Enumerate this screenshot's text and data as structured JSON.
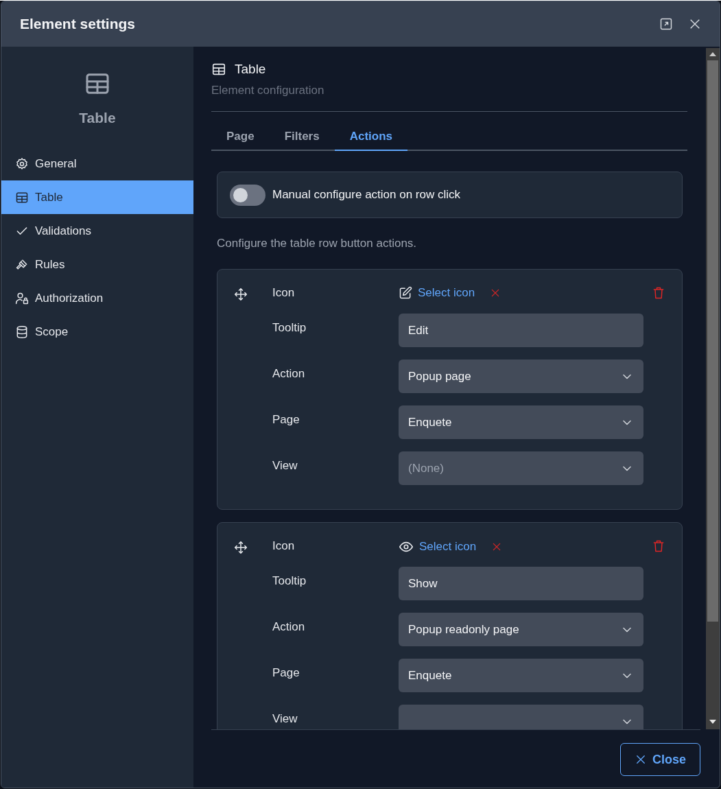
{
  "dialog": {
    "title": "Element settings"
  },
  "sidebar": {
    "element_title": "Table",
    "items": [
      {
        "label": "General",
        "selected": false
      },
      {
        "label": "Table",
        "selected": true
      },
      {
        "label": "Validations",
        "selected": false
      },
      {
        "label": "Rules",
        "selected": false
      },
      {
        "label": "Authorization",
        "selected": false
      },
      {
        "label": "Scope",
        "selected": false
      }
    ]
  },
  "content": {
    "heading": "Table",
    "subtitle": "Element configuration",
    "tabs": [
      {
        "label": "Page",
        "selected": false
      },
      {
        "label": "Filters",
        "selected": false
      },
      {
        "label": "Actions",
        "selected": true
      }
    ],
    "toggle": {
      "label": "Manual configure action on row click",
      "on": false
    },
    "description": "Configure the table row button actions.",
    "actions": [
      {
        "icon_label": "Icon",
        "select_label": "Select icon",
        "fields": [
          {
            "label": "Tooltip",
            "kind": "text",
            "value": "Edit"
          },
          {
            "label": "Action",
            "kind": "select",
            "value": "Popup page"
          },
          {
            "label": "Page",
            "kind": "select",
            "value": "Enquete"
          },
          {
            "label": "View",
            "kind": "select",
            "placeholder": "(None)"
          }
        ]
      },
      {
        "icon_label": "Icon",
        "select_label": "Select icon",
        "fields": [
          {
            "label": "Tooltip",
            "kind": "text",
            "value": "Show"
          },
          {
            "label": "Action",
            "kind": "select",
            "value": "Popup readonly page"
          },
          {
            "label": "Page",
            "kind": "select",
            "value": "Enquete"
          },
          {
            "label": "View",
            "kind": "select"
          }
        ]
      }
    ]
  },
  "footer": {
    "close_label": "Close"
  }
}
